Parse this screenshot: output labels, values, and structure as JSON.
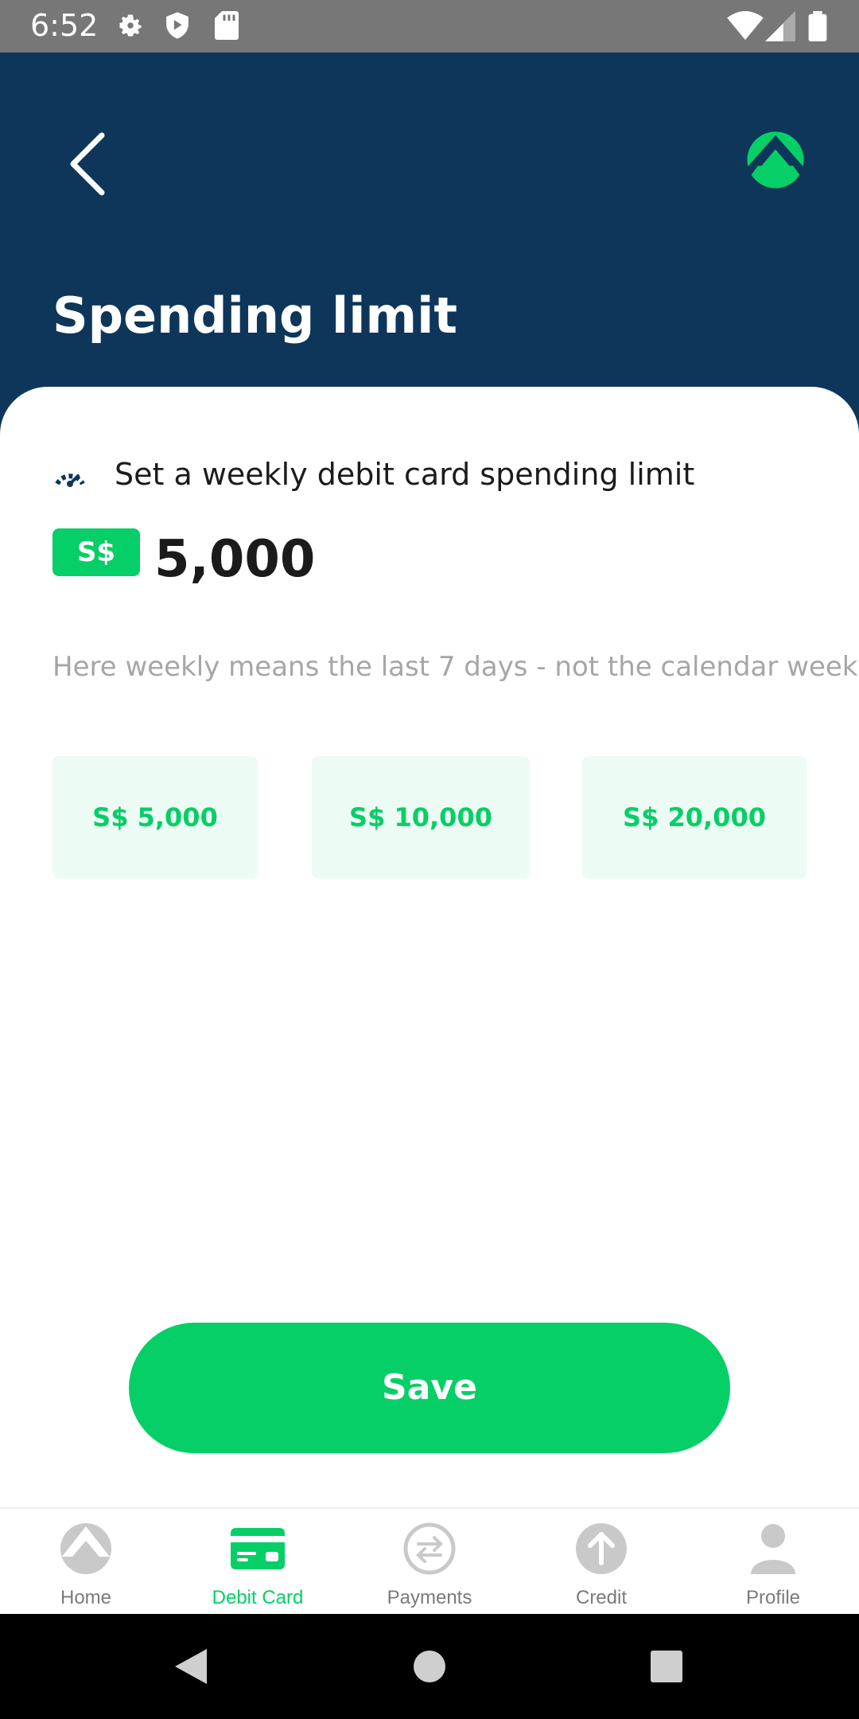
{
  "status_bar": {
    "time": "6:52",
    "icons": [
      "gear-icon",
      "shield-icon",
      "sd-card-icon",
      "wifi-icon",
      "signal-icon",
      "battery-icon"
    ]
  },
  "header": {
    "title": "Spending limit",
    "back_icon": "chevron-left-icon",
    "logo_icon": "app-logo-icon"
  },
  "limit": {
    "icon": "gauge-icon",
    "description": "Set a weekly debit card spending limit",
    "currency": "S$",
    "amount": "5,000",
    "hint": "Here weekly means the last 7 days - not the calendar week"
  },
  "presets": [
    "S$ 5,000",
    "S$ 10,000",
    "S$ 20,000"
  ],
  "save_label": "Save",
  "tabs": [
    {
      "label": "Home",
      "icon": "home-icon"
    },
    {
      "label": "Debit Card",
      "icon": "debit-card-icon"
    },
    {
      "label": "Payments",
      "icon": "payments-icon"
    },
    {
      "label": "Credit",
      "icon": "credit-icon"
    },
    {
      "label": "Profile",
      "icon": "profile-icon"
    }
  ],
  "active_tab": "Debit Card",
  "colors": {
    "header": "#0e365a",
    "accent": "#05cf66",
    "preset_bg": "#ecfbf3"
  }
}
